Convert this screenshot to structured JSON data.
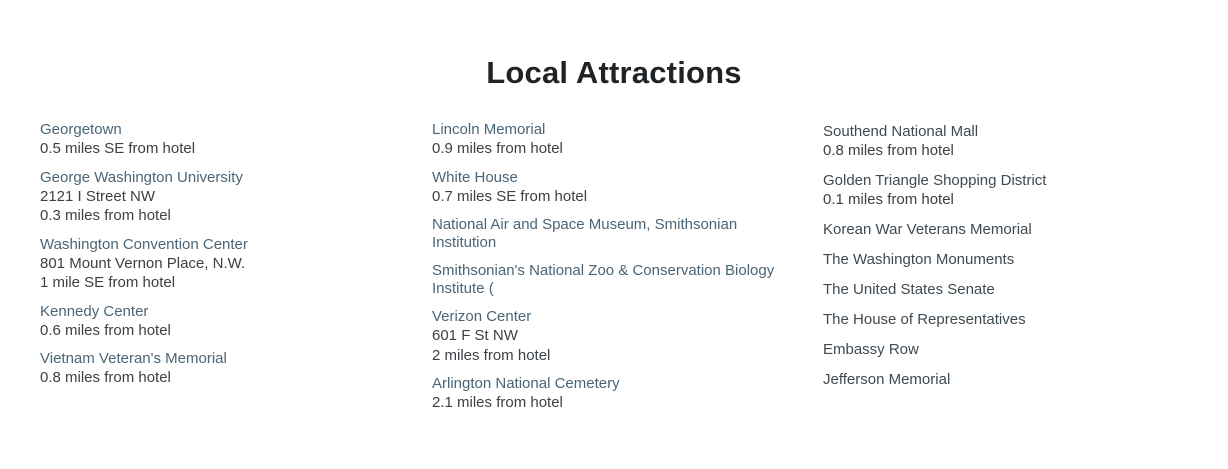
{
  "title": "Local Attractions",
  "columns": [
    {
      "items": [
        {
          "name": "Georgetown",
          "lines": [
            "0.5 miles SE from hotel"
          ]
        },
        {
          "name": "George Washington University",
          "lines": [
            "2121 I Street NW",
            "0.3 miles from hotel"
          ]
        },
        {
          "name": "Washington Convention Center",
          "lines": [
            "801 Mount Vernon Place, N.W.",
            "1 mile SE from hotel"
          ]
        },
        {
          "name": "Kennedy Center",
          "lines": [
            "0.6 miles from hotel"
          ]
        },
        {
          "name": "Vietnam Veteran's Memorial",
          "lines": [
            "0.8 miles from hotel"
          ]
        }
      ]
    },
    {
      "items": [
        {
          "name": "Lincoln Memorial",
          "lines": [
            "0.9 miles from hotel"
          ]
        },
        {
          "name": "White House",
          "lines": [
            "0.7 miles SE from hotel"
          ]
        },
        {
          "name": "National Air and Space Museum, Smithsonian Institution",
          "lines": []
        },
        {
          "name": "Smithsonian's National Zoo & Conservation Biology Institute (",
          "lines": []
        },
        {
          "name": "Verizon Center",
          "lines": [
            "601 F St NW",
            "2 miles from hotel"
          ]
        },
        {
          "name": "Arlington National Cemetery",
          "lines": [
            "2.1 miles from hotel"
          ]
        }
      ]
    },
    {
      "items": [
        {
          "name": "Southend National Mall",
          "lines": [
            "0.8 miles from hotel"
          ]
        },
        {
          "name": "Golden Triangle Shopping District",
          "lines": [
            "0.1 miles from hotel"
          ]
        },
        {
          "name": "Korean War Veterans Memorial",
          "lines": []
        },
        {
          "name": "The Washington Monuments",
          "lines": []
        },
        {
          "name": "The United States Senate",
          "lines": []
        },
        {
          "name": "The House of Representatives",
          "lines": []
        },
        {
          "name": "Embassy Row",
          "lines": []
        },
        {
          "name": "Jefferson Memorial",
          "lines": []
        }
      ]
    }
  ]
}
